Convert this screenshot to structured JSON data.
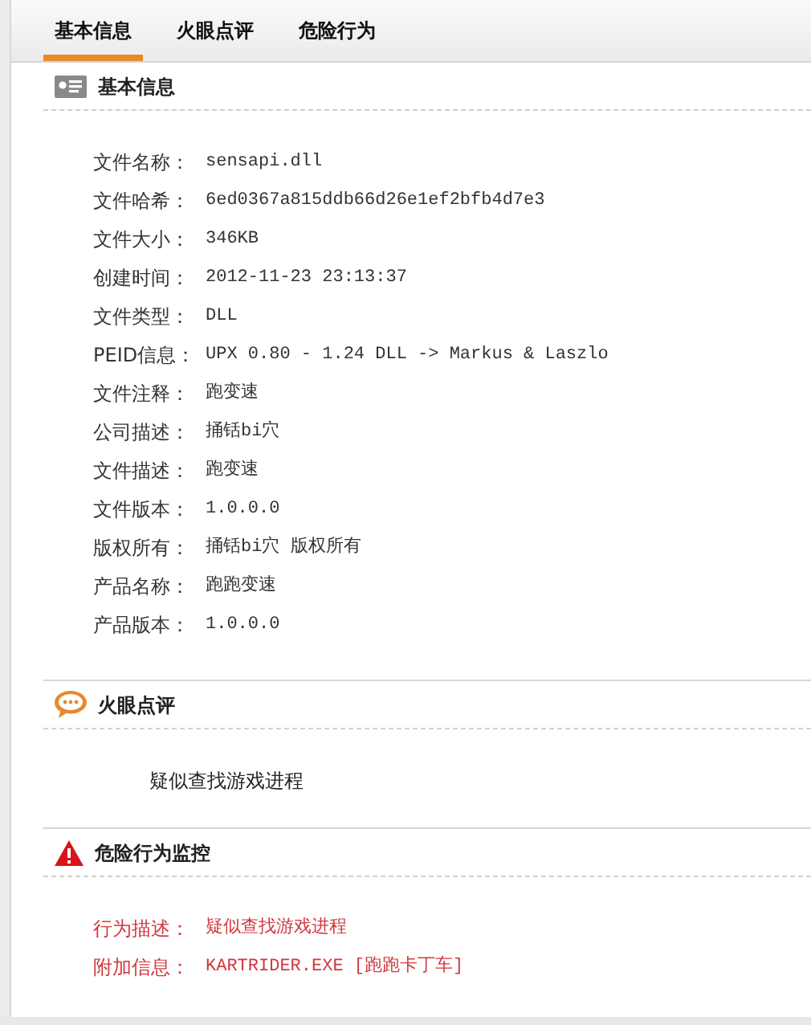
{
  "tabs": [
    {
      "label": "基本信息",
      "selected": true
    },
    {
      "label": "火眼点评",
      "selected": false
    },
    {
      "label": "危险行为",
      "selected": false
    }
  ],
  "sections": [
    {
      "kind": "info",
      "title": "基本信息",
      "rows": [
        {
          "label": "文件名称：",
          "value": "sensapi.dll"
        },
        {
          "label": "文件哈希：",
          "value": "6ed0367a815ddb66d26e1ef2bfb4d7e3"
        },
        {
          "label": "文件大小：",
          "value": "346KB"
        },
        {
          "label": "创建时间：",
          "value": "2012-11-23 23:13:37"
        },
        {
          "label": "文件类型：",
          "value": "DLL"
        },
        {
          "label": "PEID信息：",
          "value": "UPX 0.80 - 1.24 DLL -> Markus & Laszlo"
        },
        {
          "label": "文件注释：",
          "value": "跑变速"
        },
        {
          "label": "公司描述：",
          "value": "捅铦bi穴"
        },
        {
          "label": "文件描述：",
          "value": "跑变速"
        },
        {
          "label": "文件版本：",
          "value": "1.0.0.0"
        },
        {
          "label": "版权所有：",
          "value": "捅铦bi穴 版权所有"
        },
        {
          "label": "产品名称：",
          "value": "跑跑变速"
        },
        {
          "label": "产品版本：",
          "value": "1.0.0.0"
        }
      ]
    },
    {
      "kind": "comment",
      "title": "火眼点评",
      "text": "疑似查找游戏进程"
    },
    {
      "kind": "danger",
      "title": "危险行为监控",
      "rows": [
        {
          "label": "行为描述：",
          "value": "疑似查找游戏进程"
        },
        {
          "label": "附加信息：",
          "value": "KARTRIDER.EXE [跑跑卡丁车]"
        }
      ]
    }
  ]
}
